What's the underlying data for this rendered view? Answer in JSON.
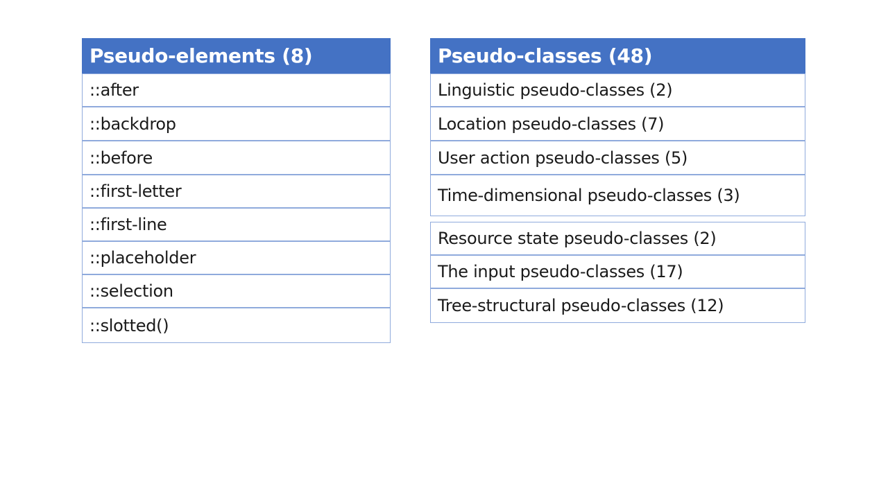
{
  "left": {
    "header": "Pseudo-elements (8)",
    "rows": [
      "::after",
      "::backdrop",
      "::before",
      "::first-letter",
      "::first-line",
      "::placeholder",
      "::selection",
      "::slotted()"
    ]
  },
  "right": {
    "header": "Pseudo-classes (48)",
    "rows_top": [
      "Linguistic pseudo-classes (2)",
      "Location pseudo-classes (7)",
      "User action pseudo-classes (5)",
      "Time-dimensional pseudo-classes (3)"
    ],
    "rows_bottom": [
      "Resource state pseudo-classes (2)",
      "The input pseudo-classes (17)",
      "Tree-structural pseudo-classes (12)"
    ]
  }
}
